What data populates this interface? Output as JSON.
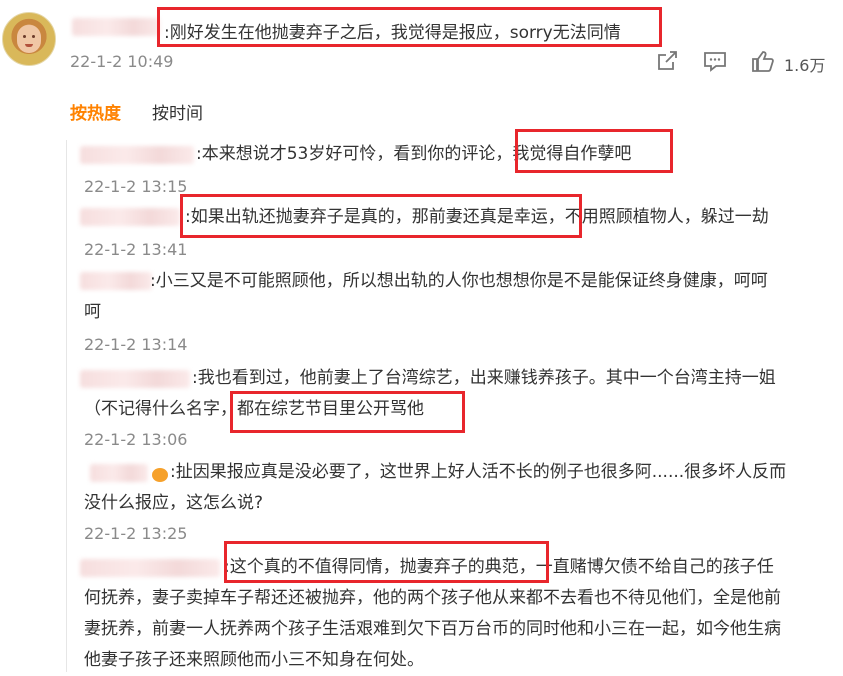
{
  "main_comment": {
    "text": ":刚好发生在他抛妻弃子之后，我觉得是报应，sorry无法同情",
    "time": "22-1-2 10:49",
    "like_count": "1.6万"
  },
  "sort_tabs": [
    "按热度",
    "按时间"
  ],
  "replies": [
    {
      "lines": [
        ":本来想说才53岁好可怜，看到你的评论，我觉得自作孽吧"
      ],
      "time": "22-1-2 13:15"
    },
    {
      "lines": [
        ":如果出轨还抛妻弃子是真的，那前妻还真是幸运，不用照顾植物人，躲过一劫"
      ],
      "time": "22-1-2 13:41"
    },
    {
      "lines": [
        ":小三又是不可能照顾他，所以想出轨的人你也想想你是不是能保证终身健康，呵呵",
        "呵"
      ],
      "time": "22-1-2 13:14"
    },
    {
      "lines": [
        ":我也看到过，他前妻上了台湾综艺，出来赚钱养孩子。其中一个台湾主持一姐",
        "（不记得什么名字，都在综艺节目里公开骂他"
      ],
      "time": "22-1-2 13:06"
    },
    {
      "lines": [
        ":扯因果报应真是没必要了，这世界上好人活不长的例子也很多阿......很多坏人反而",
        "没什么报应，这怎么说?"
      ],
      "time": "22-1-2 13:25"
    },
    {
      "lines": [
        ":这个真的不值得同情，抛妻弃子的典范，一直赌博欠债不给自己的孩子任",
        "何抚养，妻子卖掉车子帮还还被抛弃，他的两个孩子他从来都不去看也不待见他们，全是他前",
        "妻抚养，前妻一人抚养两个孩子生活艰难到欠下百万台币的同时他和小三在一起，如今他生病",
        "他妻子孩子还来照顾他而小三不知身在何处。"
      ]
    }
  ],
  "icons": [
    "share-icon",
    "comment-icon",
    "like-icon"
  ],
  "colors": {
    "highlight": "#e8262c",
    "accent": "#ff8200",
    "meta": "#8a8a8a"
  }
}
